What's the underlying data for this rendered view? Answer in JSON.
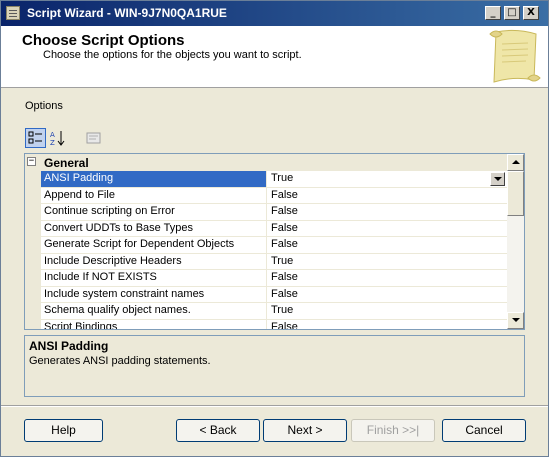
{
  "window": {
    "title": "Script Wizard - WIN-9J7N0QA1RUE",
    "controls": [
      "_",
      "□",
      "X"
    ]
  },
  "header": {
    "title": "Choose Script Options",
    "subtitle": "Choose the options for the objects you want to script."
  },
  "options_label": "Options",
  "toolbar": {
    "buttons": [
      "categorized-icon",
      "alphabetical-icon",
      "property-pages-icon"
    ]
  },
  "grid": {
    "category": "General",
    "category_toggle": "−",
    "rows": [
      {
        "name": "ANSI Padding",
        "value": "True"
      },
      {
        "name": "Append to File",
        "value": "False"
      },
      {
        "name": "Continue scripting on Error",
        "value": "False"
      },
      {
        "name": "Convert UDDTs to Base Types",
        "value": "False"
      },
      {
        "name": "Generate Script for Dependent Objects",
        "value": "False"
      },
      {
        "name": "Include Descriptive Headers",
        "value": "True"
      },
      {
        "name": "Include If NOT EXISTS",
        "value": "False"
      },
      {
        "name": "Include system constraint names",
        "value": "False"
      },
      {
        "name": "Schema qualify object names.",
        "value": "True"
      },
      {
        "name": "Script Bindings",
        "value": "False"
      }
    ],
    "selected_index": 0
  },
  "description": {
    "title": "ANSI Padding",
    "text": "Generates ANSI padding statements."
  },
  "buttons": {
    "help": "Help",
    "back": "< Back",
    "next": "Next >",
    "finish": "Finish >>|",
    "cancel": "Cancel"
  },
  "colors": {
    "selection": "#316ac5",
    "title_bar": "#0a246a",
    "panel": "#ece9d8"
  }
}
